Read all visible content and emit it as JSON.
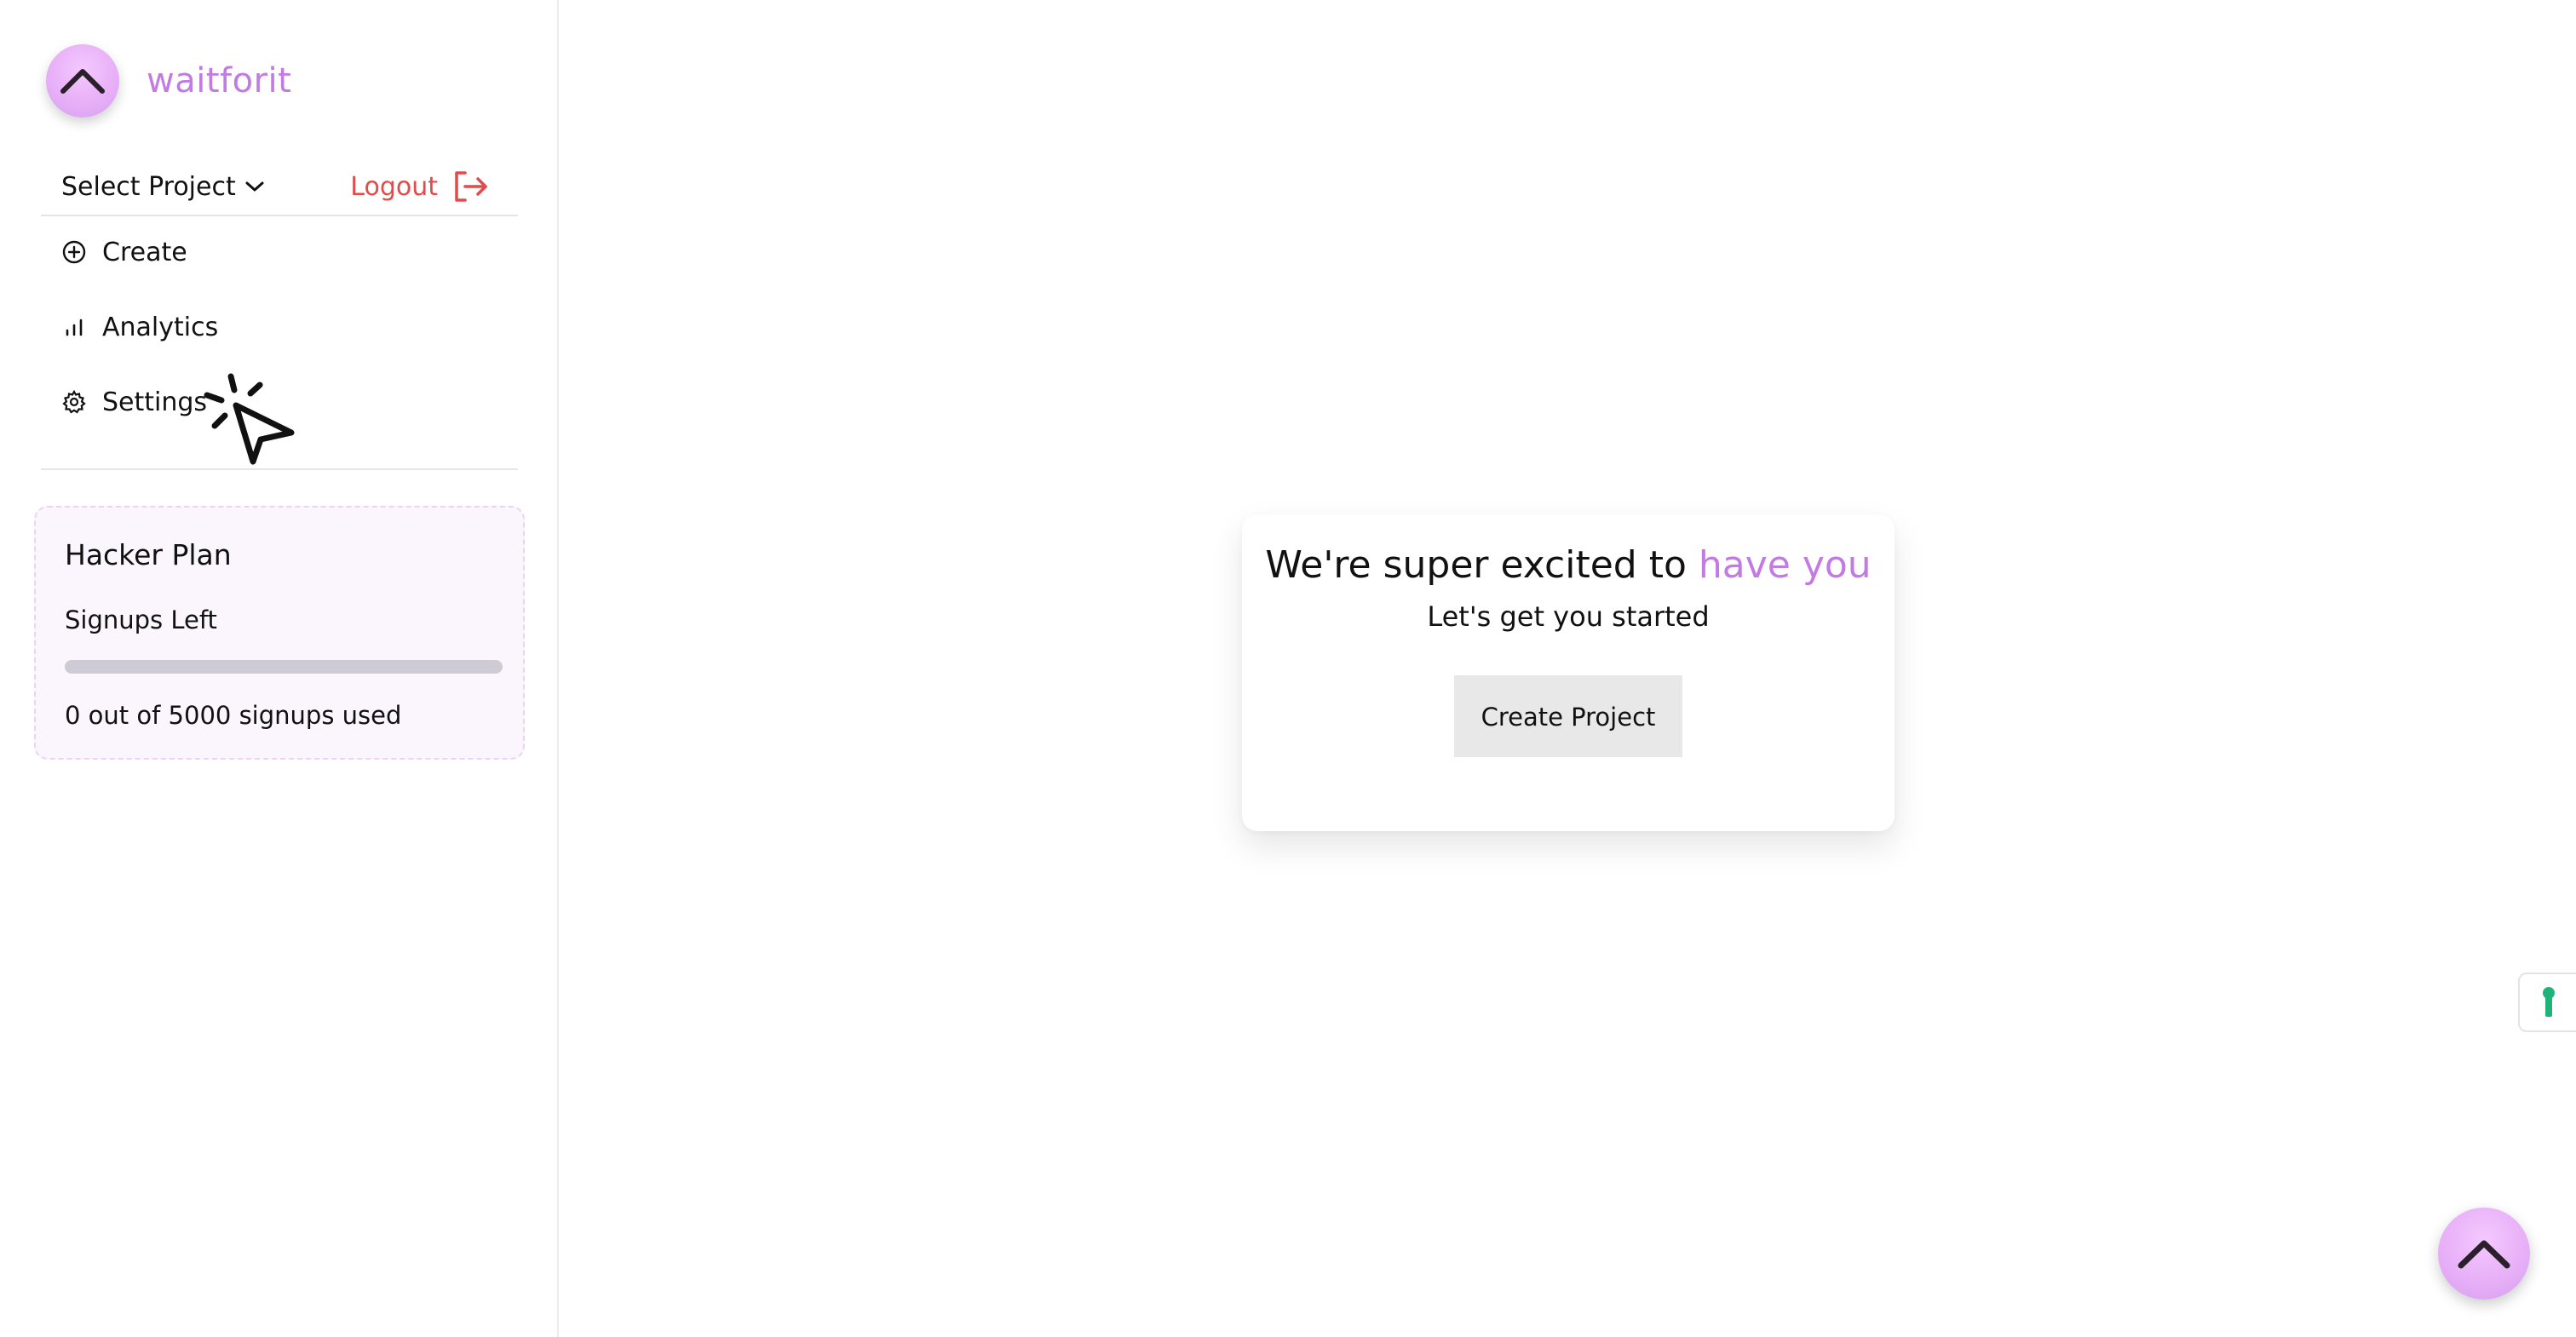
{
  "brand": {
    "name": "waitforit",
    "accent_color": "#c17be3",
    "logo_icon": "chevron-up-icon"
  },
  "sidebar": {
    "select_project_label": "Select Project",
    "logout_label": "Logout",
    "logout_color": "#e34a4a",
    "nav": [
      {
        "label": "Create",
        "icon": "plus-circle-icon"
      },
      {
        "label": "Analytics",
        "icon": "bar-chart-icon"
      },
      {
        "label": "Settings",
        "icon": "gear-icon"
      }
    ]
  },
  "plan": {
    "title": "Hacker Plan",
    "subtitle": "Signups Left",
    "used": 0,
    "total": 5000,
    "usage_text": "0 out of 5000 signups used"
  },
  "welcome": {
    "title_prefix": "We're super excited to ",
    "title_accent": "have you",
    "subtitle": "Let's get you started",
    "button_label": "Create Project"
  },
  "widgets": {
    "side_tab_icon": "keyhole-icon",
    "side_tab_color": "#1fb37a",
    "fab_icon": "chevron-up-icon"
  }
}
